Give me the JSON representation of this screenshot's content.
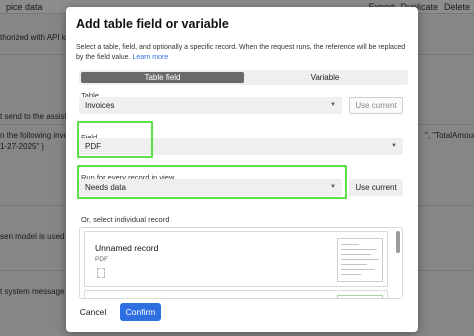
{
  "background": {
    "title": "pice data",
    "actions": [
      "Export",
      "Duplicate",
      "Delete"
    ],
    "lines": [
      "thorized with API k",
      "t send to the assistant. Y",
      "n the following invoi",
      "1-27-2025\" }",
      "\", \"TotalAmount\"",
      "sen model is used fo",
      "t system message of"
    ]
  },
  "modal": {
    "title": "Add table field or variable",
    "description": "Select a table, field, and optionally a specific record. When the request runs, the reference will be replaced by the field value.",
    "learn_more": "Learn more",
    "tabs": [
      {
        "label": "Table field",
        "active": true
      },
      {
        "label": "Variable",
        "active": false
      }
    ],
    "table": {
      "label": "Table",
      "value": "Invoices",
      "button": "Use current"
    },
    "field": {
      "label": "Field",
      "value": "PDF"
    },
    "run_for": {
      "label": "Run for every record in view",
      "value": "Needs data",
      "button": "Use current"
    },
    "records": {
      "label": "Or, select individual record",
      "items": [
        {
          "title": "Unnamed record",
          "field": "PDF"
        }
      ]
    },
    "cancel": "Cancel",
    "confirm": "Confirm"
  },
  "colors": {
    "highlight": "#5ee04a",
    "confirm": "#2f6fe0",
    "link": "#2f6fe0",
    "active_tab": "#6a6a6a"
  },
  "icons": [
    "chevron-down-icon",
    "document-thumbnail-icon"
  ]
}
